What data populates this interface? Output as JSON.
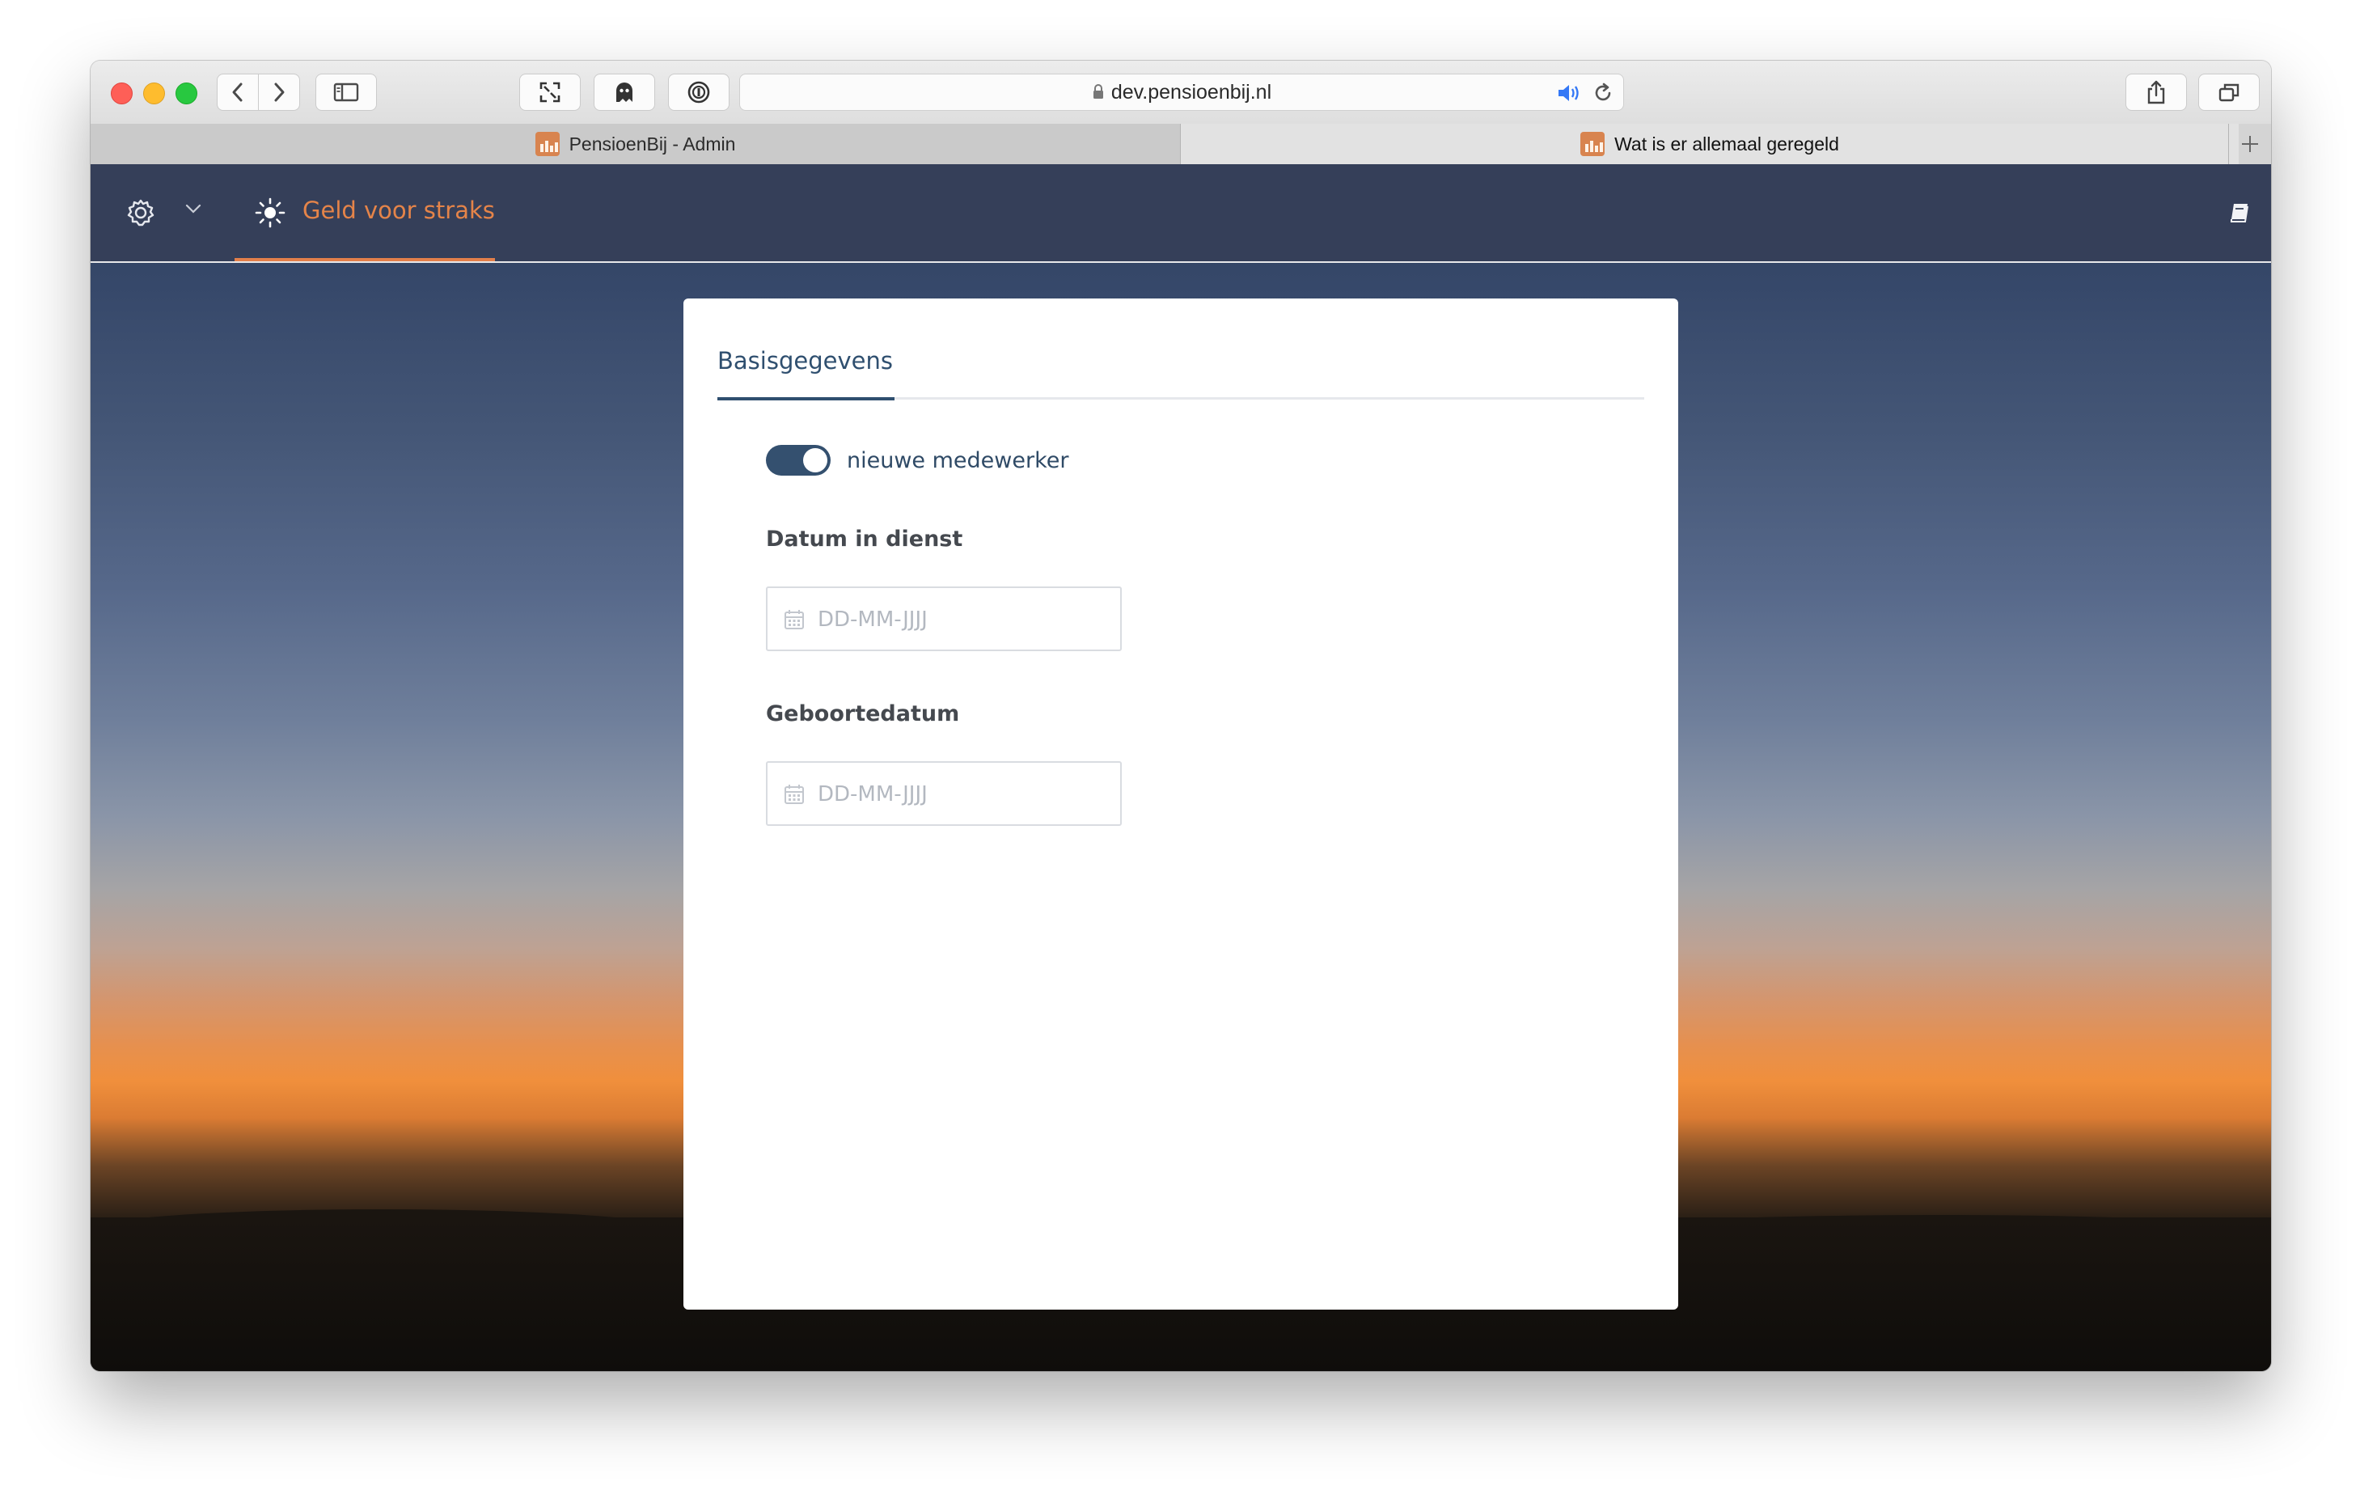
{
  "browser": {
    "url": "dev.pensioenbij.nl",
    "tabs": [
      {
        "label": "PensioenBij - Admin"
      },
      {
        "label": "Wat is er allemaal geregeld"
      }
    ]
  },
  "nav": {
    "active_tab_label": "Geld voor straks",
    "accent_color": "#e58449",
    "background_color": "#353f59"
  },
  "card": {
    "tab_label": "Basisgegevens",
    "toggle": {
      "label": "nieuwe medewerker",
      "on": true
    },
    "fields": [
      {
        "label": "Datum in dienst",
        "placeholder": "DD-MM-JJJJ",
        "value": ""
      },
      {
        "label": "Geboortedatum",
        "placeholder": "DD-MM-JJJJ",
        "value": ""
      }
    ]
  },
  "icons": {
    "nav_settings": "gear-icon",
    "nav_dropdown": "chevron-down-icon",
    "nav_tab": "sun-icon",
    "nav_right": "book-icon",
    "field": "calendar-icon"
  }
}
